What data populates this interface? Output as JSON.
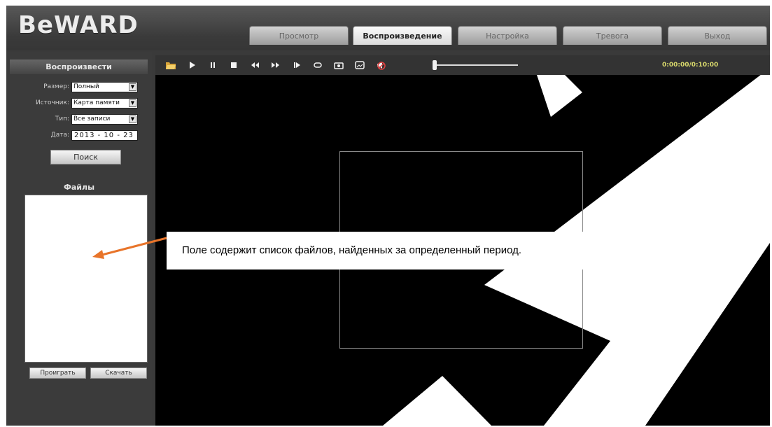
{
  "header": {
    "logo": "BeWARD",
    "tabs": [
      {
        "label": "Просмотр",
        "active": false
      },
      {
        "label": "Воспроизведение",
        "active": true
      },
      {
        "label": "Настройка",
        "active": false
      },
      {
        "label": "Тревога",
        "active": false
      },
      {
        "label": "Выход",
        "active": false
      }
    ]
  },
  "sidebar": {
    "title": "Воспроизвести",
    "size_label": "Размер:",
    "size_value": "Полный",
    "source_label": "Источник:",
    "source_value": "Карта памяти",
    "type_label": "Тип:",
    "type_value": "Все записи",
    "date_label": "Дата:",
    "date_value": "2013 - 10 - 23",
    "search_button": "Поиск",
    "files_title": "Файлы",
    "play_button": "Проиграть",
    "download_button": "Скачать"
  },
  "toolbar": {
    "timecode": "0:00:00/0:10:00",
    "position_fraction": 0.0,
    "icons": [
      "open-folder-icon",
      "play-icon",
      "pause-icon",
      "stop-icon",
      "rewind-icon",
      "fast-forward-icon",
      "step-forward-icon",
      "loop-icon",
      "camera-icon",
      "image-icon",
      "mute-icon"
    ]
  },
  "annotation": {
    "text": "Поле содержит список файлов, найденных за определенный период.",
    "arrow_color": "#e8742a"
  },
  "colors": {
    "accent_tab": "#e6e6e6",
    "background": "#3a3a3a",
    "video": "#000000"
  }
}
